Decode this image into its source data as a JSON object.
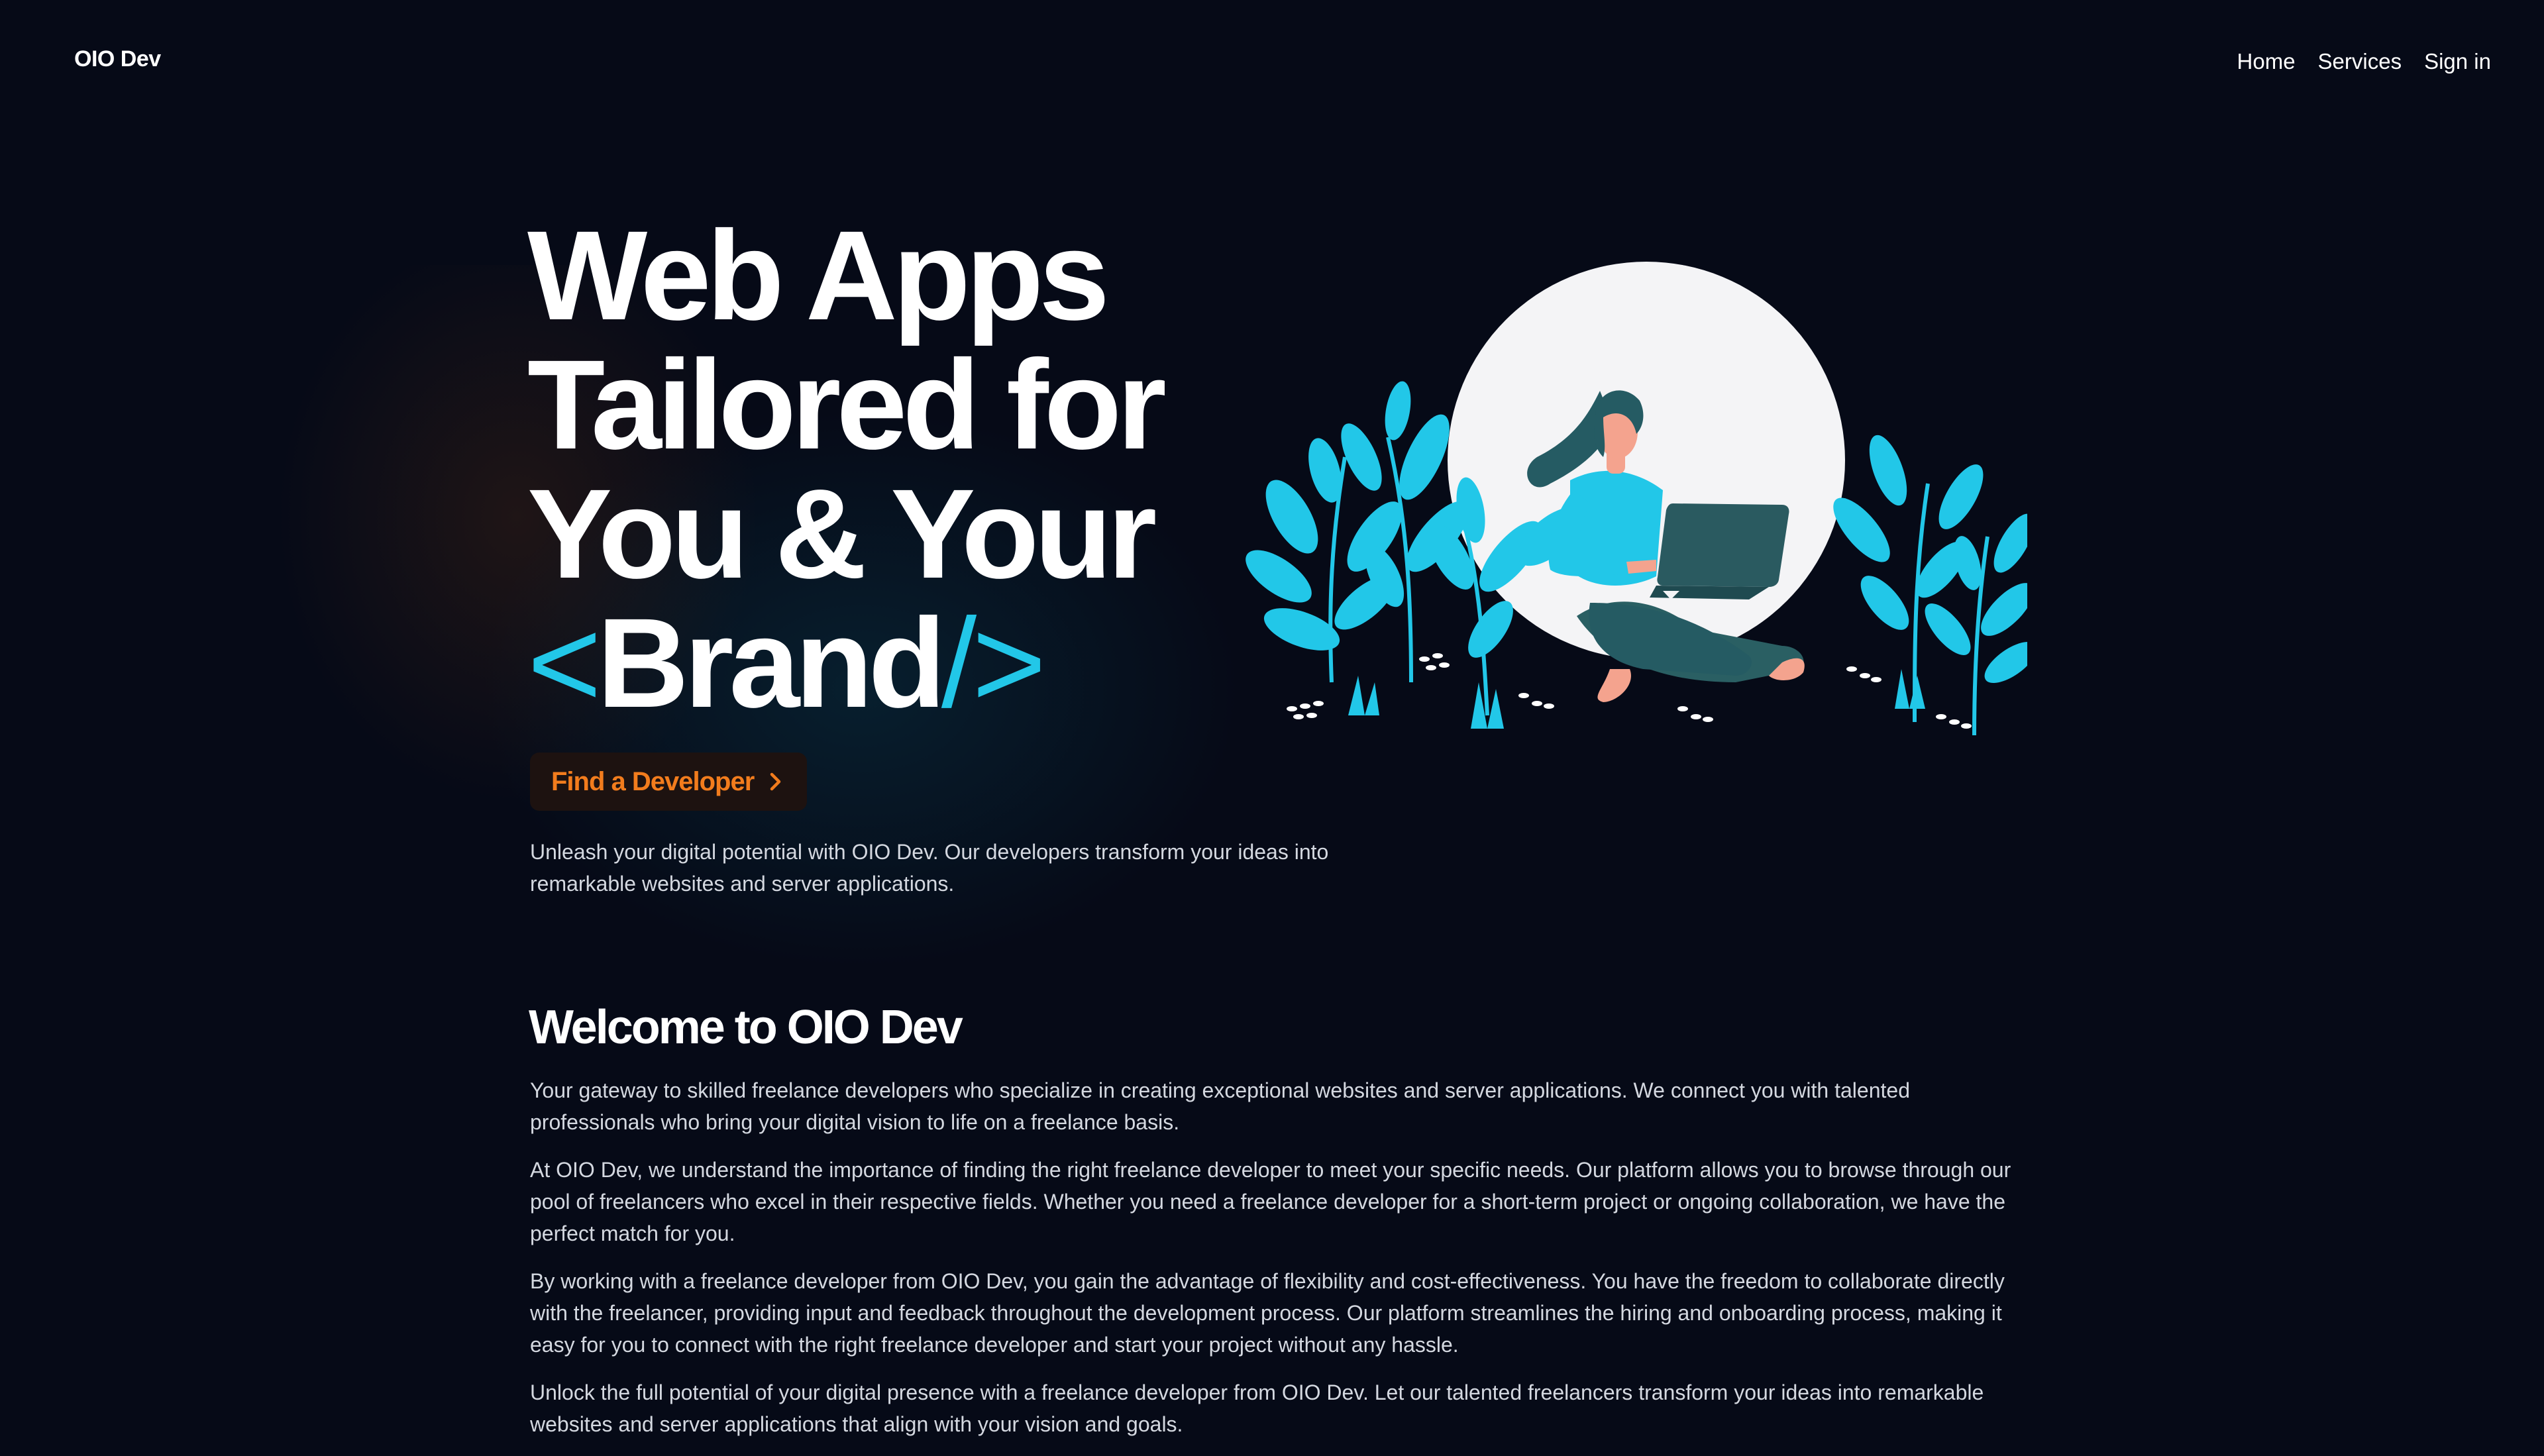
{
  "header": {
    "logo": "OIO Dev",
    "nav": [
      {
        "label": "Home"
      },
      {
        "label": "Services"
      },
      {
        "label": "Sign in"
      }
    ]
  },
  "hero": {
    "title_lines": [
      "Web Apps",
      "Tailored for",
      "You & Your"
    ],
    "title_open_bracket": "<",
    "title_brand": "Brand",
    "title_close_bracket": "/>",
    "cta_label": "Find a Developer",
    "cta_icon": "chevron-right-icon",
    "description": "Unleash your digital potential with OIO Dev. Our developers transform your ideas into remarkable websites and server applications.",
    "illustration": "woman-with-laptop-illustration"
  },
  "welcome": {
    "title": "Welcome to OIO Dev",
    "paragraphs": [
      "Your gateway to skilled freelance developers who specialize in creating exceptional websites and server applications. We connect you with talented professionals who bring your digital vision to life on a freelance basis.",
      "At OIO Dev, we understand the importance of finding the right freelance developer to meet your specific needs. Our platform allows you to browse through our pool of freelancers who excel in their respective fields. Whether you need a freelance developer for a short-term project or ongoing collaboration, we have the perfect match for you.",
      "By working with a freelance developer from OIO Dev, you gain the advantage of flexibility and cost-effectiveness. You have the freedom to collaborate directly with the freelancer, providing input and feedback throughout the development process. Our platform streamlines the hiring and onboarding process, making it easy for you to connect with the right freelance developer and start your project without any hassle.",
      "Unlock the full potential of your digital presence with a freelance developer from OIO Dev. Let our talented freelancers transform your ideas into remarkable websites and server applications that align with your vision and goals."
    ]
  },
  "colors": {
    "background": "#060a17",
    "accent_cyan": "#22c7e8",
    "cta_orange": "#f27c1d",
    "cta_background": "#1d1210",
    "text": "#ffffff",
    "muted_text": "#d4d8e0"
  }
}
